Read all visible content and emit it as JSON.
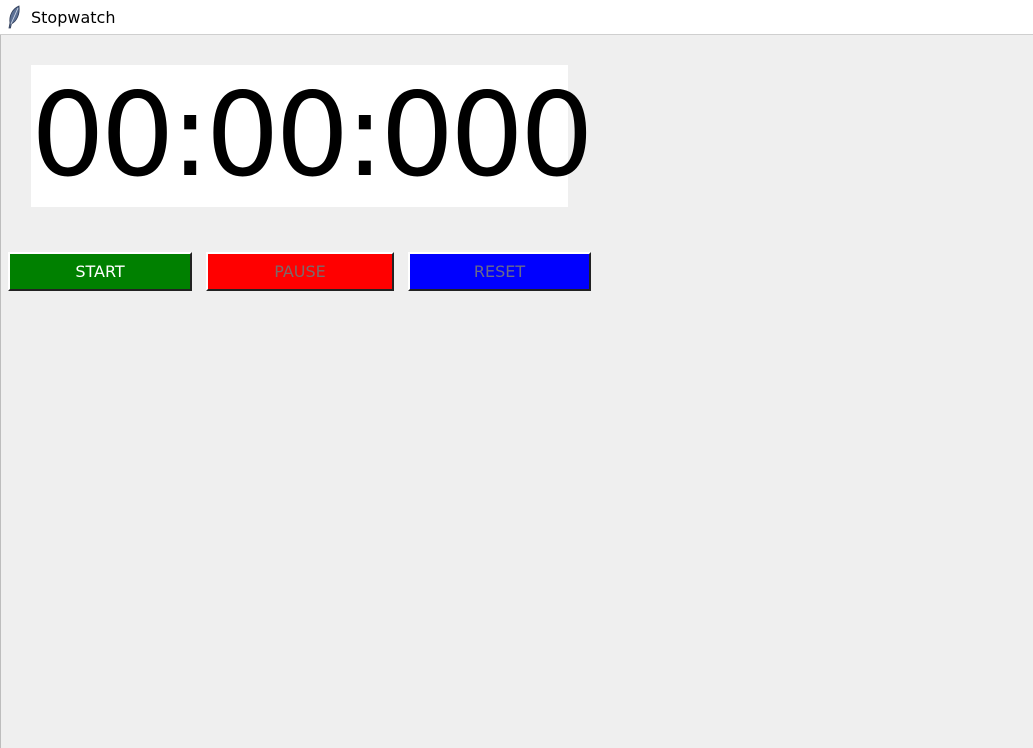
{
  "window": {
    "title": "Stopwatch",
    "icon": "feather-icon"
  },
  "display": {
    "time": "00:00:000"
  },
  "buttons": {
    "start": {
      "label": "START",
      "bg": "#008000",
      "fg": "#ffffff",
      "enabled": true
    },
    "pause": {
      "label": "PAUSE",
      "bg": "#ff0000",
      "fg": "#7a6a6a",
      "enabled": false
    },
    "reset": {
      "label": "RESET",
      "bg": "#0000ff",
      "fg": "#6a6a8a",
      "enabled": false
    }
  }
}
